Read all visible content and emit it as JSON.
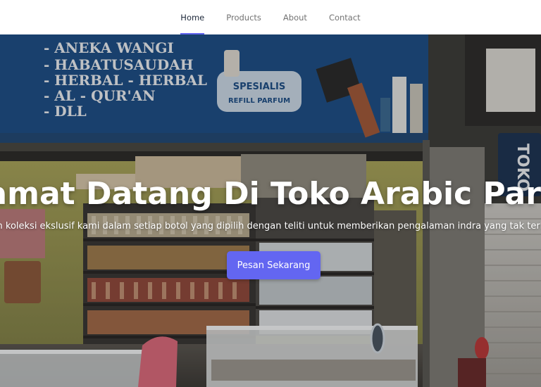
{
  "nav": {
    "items": [
      {
        "label": "Home",
        "active": true
      },
      {
        "label": "Products",
        "active": false
      },
      {
        "label": "About",
        "active": false
      },
      {
        "label": "Contact",
        "active": false
      }
    ]
  },
  "hero": {
    "title": "Selamat Datang Di Toko Arabic Parfum",
    "subtitle": "Temukan koleksi ekslusif kami dalam setiap botol yang dipilih dengan teliti untuk memberikan pengalaman indra yang tak terlupakan.",
    "cta_label": "Pesan Sekarang",
    "photo_signage": {
      "board_lines": [
        "- ANEKA WANGI",
        "- HABATUSAUDAH",
        "- HERBAL - HERBAL",
        "- AL - QUR'AN",
        "- DLL"
      ],
      "badge_lines": [
        "SPESIALIS",
        "REFILL PARFUM"
      ],
      "side_sign": "TOKO"
    }
  },
  "colors": {
    "accent": "#6366f1",
    "nav_text": "#737373",
    "nav_active_text": "#1e293b"
  }
}
